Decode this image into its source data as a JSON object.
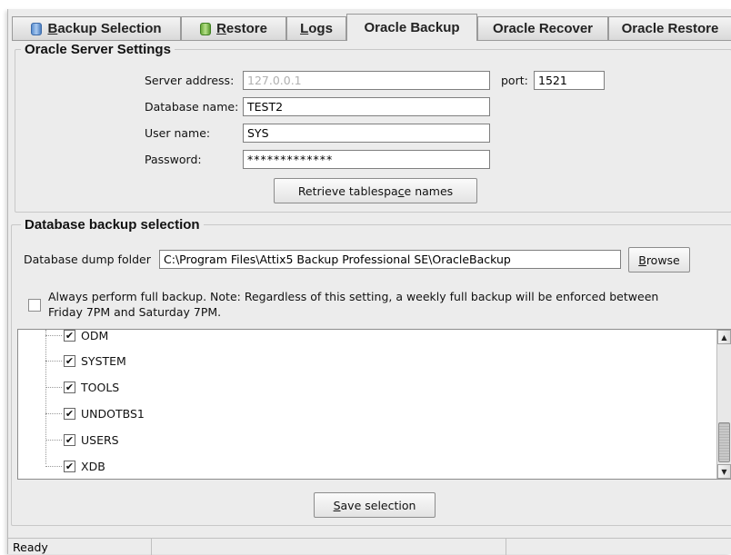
{
  "tabs": [
    {
      "label_pre": "",
      "label_ul": "B",
      "label_post": "ackup Selection",
      "icon": "database-icon"
    },
    {
      "label_pre": "",
      "label_ul": "R",
      "label_post": "estore",
      "icon": "restore-icon"
    },
    {
      "label_pre": "",
      "label_ul": "L",
      "label_post": "ogs",
      "icon": ""
    },
    {
      "label_pre": "Oracle Backup",
      "label_ul": "",
      "label_post": "",
      "icon": ""
    },
    {
      "label_pre": "Oracle Recover",
      "label_ul": "",
      "label_post": "",
      "icon": ""
    },
    {
      "label_pre": "Oracle Restore",
      "label_ul": "",
      "label_post": "",
      "icon": ""
    }
  ],
  "active_tab": "Oracle Backup",
  "server_settings": {
    "title": "Oracle Server Settings",
    "server_address_label": "Server address:",
    "server_address_value": "127.0.0.1",
    "port_label": "port:",
    "port_value": "1521",
    "database_name_label": "Database name:",
    "database_name_value": "TEST2",
    "user_name_label": "User name:",
    "user_name_value": "SYS",
    "password_label": "Password:",
    "password_value": "*************",
    "retrieve_button_pre": "Retrieve tablespa",
    "retrieve_button_ul": "c",
    "retrieve_button_post": "e names"
  },
  "backup_selection": {
    "title": "Database backup selection",
    "dump_folder_label": "Database dump folder",
    "dump_folder_value": "C:\\Program Files\\Attix5 Backup Professional SE\\OracleBackup",
    "browse_button_ul": "B",
    "browse_button_post": "rowse",
    "full_backup_text_line1": "Always perform full backup. Note: Regardless of this setting, a weekly full backup will be enforced between",
    "full_backup_text_line2": "Friday 7PM and Saturday 7PM.",
    "full_backup_checked": false,
    "tablespaces": [
      {
        "name": "ODM",
        "checked": true
      },
      {
        "name": "SYSTEM",
        "checked": true
      },
      {
        "name": "TOOLS",
        "checked": true
      },
      {
        "name": "UNDOTBS1",
        "checked": true
      },
      {
        "name": "USERS",
        "checked": true
      },
      {
        "name": "XDB",
        "checked": true
      }
    ],
    "check_glyph": "✔"
  },
  "save_button_ul": "S",
  "save_button_post": "ave selection",
  "status": {
    "text": "Ready"
  },
  "scroll": {
    "up_glyph": "▲",
    "down_glyph": "▼"
  }
}
